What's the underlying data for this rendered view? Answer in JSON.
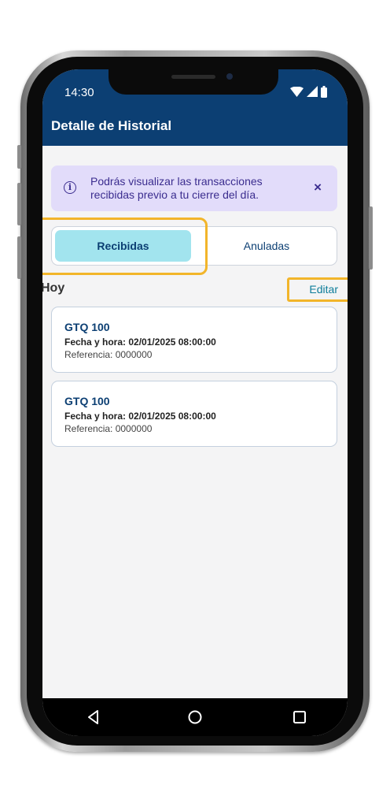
{
  "status_bar": {
    "time": "14:30"
  },
  "header": {
    "title": "Detalle de Historial"
  },
  "info_banner": {
    "text": "Podrás visualizar las transacciones recibidas previo a tu cierre del día.",
    "close_label": "×",
    "icon": "info-icon"
  },
  "tabs": [
    {
      "label": "Recibidas",
      "selected": true
    },
    {
      "label": "Anuladas",
      "selected": false
    }
  ],
  "section": {
    "title": "Hoy",
    "edit_label": "Editar"
  },
  "transactions": [
    {
      "amount": "GTQ 100",
      "datetime": "Fecha y hora: 02/01/2025 08:00:00",
      "reference": "Referencia: 0000000"
    },
    {
      "amount": "GTQ 100",
      "datetime": "Fecha y hora: 02/01/2025 08:00:00",
      "reference": "Referencia: 0000000"
    }
  ],
  "nav": {
    "icons": [
      "back-icon",
      "home-icon",
      "recents-icon"
    ]
  },
  "colors": {
    "primary": "#0c3f73",
    "tab_active": "#a2e4ee",
    "banner_bg": "#e2dcfa",
    "banner_text": "#3b2d8f",
    "highlight": "#f2b52a",
    "link": "#0e7d9a"
  }
}
